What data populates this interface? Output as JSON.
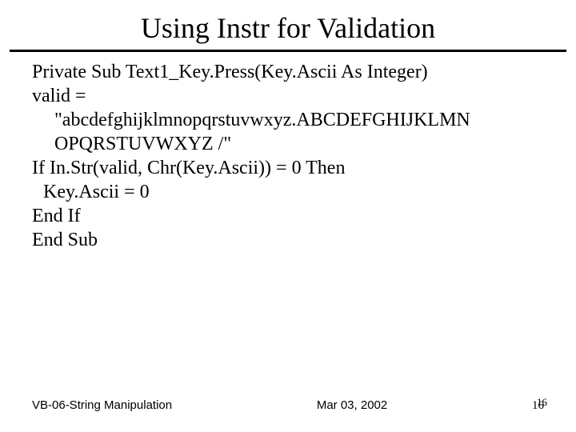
{
  "title": "Using Instr for Validation",
  "code": {
    "l1": "Private Sub Text1_Key.Press(Key.Ascii As Integer)",
    "l2": "valid =",
    "l3": "\"abcdefghijklmnopqrstuvwxyz.ABCDEFGHIJKLMN",
    "l4": "OPQRSTUVWXYZ /\"",
    "l5": "If In.Str(valid, Chr(Key.Ascii)) = 0 Then",
    "l6": "Key.Ascii = 0",
    "l7": "End If",
    "l8": "End Sub"
  },
  "footer": {
    "left": "VB-06-String Manipulation",
    "center": "Mar 03, 2002",
    "right_main": "16",
    "right_overlay": "16"
  }
}
